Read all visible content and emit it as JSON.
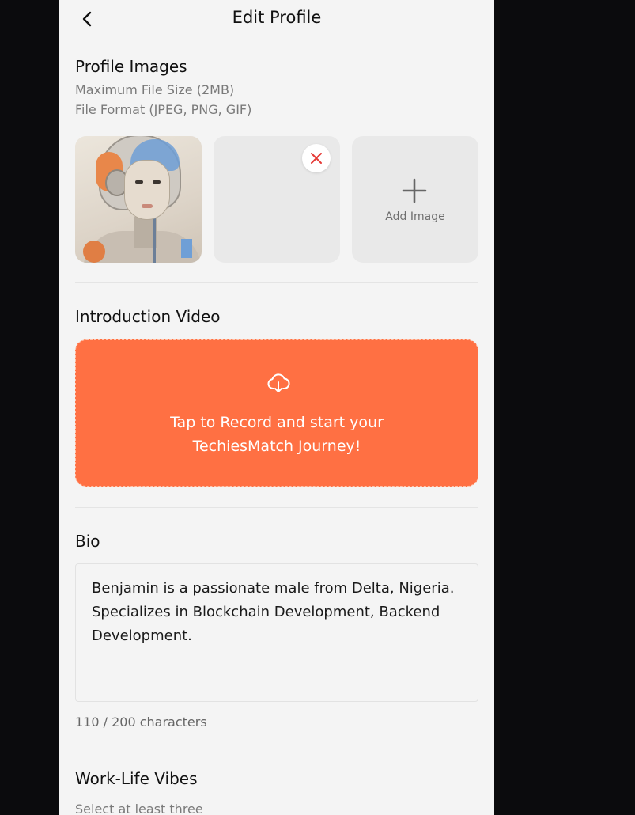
{
  "header": {
    "title": "Edit Profile"
  },
  "profile_images": {
    "title": "Profile Images",
    "max_size": "Maximum File Size (2MB)",
    "formats": "File Format (JPEG, PNG, GIF)",
    "add_label": "Add Image"
  },
  "intro_video": {
    "title": "Introduction Video",
    "prompt_line1": "Tap to Record and start your",
    "prompt_line2": "TechiesMatch Journey!"
  },
  "bio": {
    "title": "Bio",
    "text": "Benjamin is a passionate male from Delta, Nigeria. Specializes in Blockchain Development, Backend Development.",
    "char_count": "110 / 200 characters"
  },
  "work_life": {
    "title": "Work-Life Vibes",
    "hint": "Select at least three"
  },
  "colors": {
    "accent": "#ff7043",
    "remove_icon": "#e53935",
    "background": "#f4f4f4",
    "outer": "#0b0b0d"
  },
  "icons": [
    "back-arrow-icon",
    "close-icon",
    "plus-icon",
    "cloud-download-icon"
  ]
}
